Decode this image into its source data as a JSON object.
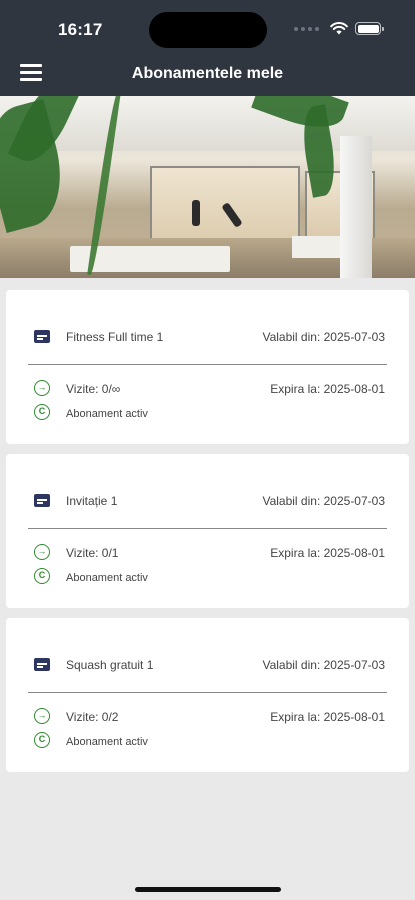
{
  "status_bar": {
    "time": "16:17"
  },
  "header": {
    "title": "Abonamentele mele"
  },
  "subscriptions": [
    {
      "name": "Fitness Full time 1",
      "valid_from": "Valabil din: 2025-07-03",
      "visits": "Vizite: 0/∞",
      "expires": "Expira la: 2025-08-01",
      "status": "Abonament activ"
    },
    {
      "name": "Invitație 1",
      "valid_from": "Valabil din: 2025-07-03",
      "visits": "Vizite: 0/1",
      "expires": "Expira la: 2025-08-01",
      "status": "Abonament activ"
    },
    {
      "name": "Squash gratuit 1",
      "valid_from": "Valabil din: 2025-07-03",
      "visits": "Vizite: 0/2",
      "expires": "Expira la: 2025-08-01",
      "status": "Abonament activ"
    }
  ],
  "icons": {
    "menu": "menu-icon",
    "card": "card-icon",
    "visits": "login-arrow-icon",
    "status": "copyright-circle-icon",
    "wifi": "wifi-icon",
    "battery": "battery-icon"
  },
  "colors": {
    "header_bg": "#2f3640",
    "accent_green": "#2f8a2f",
    "card_icon": "#2d3561",
    "background": "#e9e9e9"
  }
}
